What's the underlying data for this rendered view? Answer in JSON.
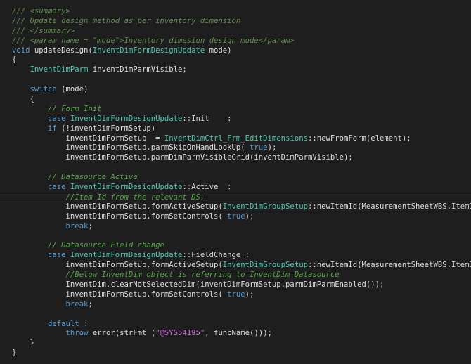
{
  "editor": {
    "current_line_index": 19,
    "caret_line_index": 19,
    "colors": {
      "background": "#1e1e1e",
      "plain": "#dcdcdc",
      "keyword": "#569cd6",
      "type": "#4ec9b0",
      "comment": "#57a64a",
      "doc": "#608b4e",
      "string": "#d69d85",
      "macro": "#d16fe0"
    },
    "lines": [
      [
        [
          "doc",
          "/// <summary>"
        ]
      ],
      [
        [
          "doc",
          "/// Update design method as per inventory dimension"
        ]
      ],
      [
        [
          "doc",
          "/// </summary>"
        ]
      ],
      [
        [
          "doc",
          "/// <param name = \"mode\">Inventory dimesion design mode</param>"
        ]
      ],
      [
        [
          "keyword",
          "void"
        ],
        [
          "plain",
          " updateDesign("
        ],
        [
          "type",
          "InventDimFormDesignUpdate"
        ],
        [
          "plain",
          " mode)"
        ]
      ],
      [
        [
          "plain",
          "{"
        ]
      ],
      [
        [
          "plain",
          "    "
        ],
        [
          "type",
          "InventDimParm"
        ],
        [
          "plain",
          " inventDimParmVisible;"
        ]
      ],
      [
        [
          "plain",
          ""
        ]
      ],
      [
        [
          "plain",
          "    "
        ],
        [
          "keyword",
          "switch"
        ],
        [
          "plain",
          " (mode)"
        ]
      ],
      [
        [
          "plain",
          "    {"
        ]
      ],
      [
        [
          "plain",
          "        "
        ],
        [
          "comment",
          "// Form Init"
        ]
      ],
      [
        [
          "plain",
          "        "
        ],
        [
          "keyword",
          "case"
        ],
        [
          "plain",
          " "
        ],
        [
          "type",
          "InventDimFormDesignUpdate"
        ],
        [
          "plain",
          "::Init    :"
        ]
      ],
      [
        [
          "plain",
          "        "
        ],
        [
          "keyword",
          "if"
        ],
        [
          "plain",
          " (!inventDimFormSetup)"
        ]
      ],
      [
        [
          "plain",
          "            inventDimFormSetup  = "
        ],
        [
          "type",
          "InventDimCtrl_Frm_EditDimensions"
        ],
        [
          "plain",
          "::newFromForm(element);"
        ]
      ],
      [
        [
          "plain",
          "            inventDimFormSetup.parmSkipOnHandLookUp( "
        ],
        [
          "keyword",
          "true"
        ],
        [
          "plain",
          ");"
        ]
      ],
      [
        [
          "plain",
          "            inventDimFormSetup.parmDimParmVisibleGrid(inventDimParmVisible);"
        ]
      ],
      [
        [
          "plain",
          ""
        ]
      ],
      [
        [
          "plain",
          "        "
        ],
        [
          "comment",
          "// Datasource Active"
        ]
      ],
      [
        [
          "plain",
          "        "
        ],
        [
          "keyword",
          "case"
        ],
        [
          "plain",
          " "
        ],
        [
          "type",
          "InventDimFormDesignUpdate"
        ],
        [
          "plain",
          "::Active  :"
        ]
      ],
      [
        [
          "plain",
          "            "
        ],
        [
          "comment",
          "//Item Id from the relevant DS."
        ]
      ],
      [
        [
          "plain",
          "            inventDimFormSetup.formActiveSetup("
        ],
        [
          "type",
          "InventDimGroupSetup"
        ],
        [
          "plain",
          "::newItemId(MeasurementSheetWBS.ItemId));"
        ]
      ],
      [
        [
          "plain",
          "            inventDimFormSetup.formSetControls( "
        ],
        [
          "keyword",
          "true"
        ],
        [
          "plain",
          ");"
        ]
      ],
      [
        [
          "plain",
          "            "
        ],
        [
          "keyword",
          "break"
        ],
        [
          "plain",
          ";"
        ]
      ],
      [
        [
          "plain",
          ""
        ]
      ],
      [
        [
          "plain",
          "        "
        ],
        [
          "comment",
          "// Datasource Field change"
        ]
      ],
      [
        [
          "plain",
          "        "
        ],
        [
          "keyword",
          "case"
        ],
        [
          "plain",
          " "
        ],
        [
          "type",
          "InventDimFormDesignUpdate"
        ],
        [
          "plain",
          "::FieldChange :"
        ]
      ],
      [
        [
          "plain",
          "            inventDimFormSetup.formActiveSetup("
        ],
        [
          "type",
          "InventDimGroupSetup"
        ],
        [
          "plain",
          "::newItemId(MeasurementSheetWBS.ItemId));"
        ]
      ],
      [
        [
          "plain",
          "            "
        ],
        [
          "comment",
          "//Below InventDim object is referring to InventDim Datasource"
        ]
      ],
      [
        [
          "plain",
          "            InventDim.clearNotSelectedDim(inventDimFormSetup.parmDimParmEnabled());"
        ]
      ],
      [
        [
          "plain",
          "            inventDimFormSetup.formSetControls( "
        ],
        [
          "keyword",
          "true"
        ],
        [
          "plain",
          ");"
        ]
      ],
      [
        [
          "plain",
          "            "
        ],
        [
          "keyword",
          "break"
        ],
        [
          "plain",
          ";"
        ]
      ],
      [
        [
          "plain",
          ""
        ]
      ],
      [
        [
          "plain",
          "        "
        ],
        [
          "keyword",
          "default"
        ],
        [
          "plain",
          " :"
        ]
      ],
      [
        [
          "plain",
          "            "
        ],
        [
          "keyword",
          "throw"
        ],
        [
          "plain",
          " error(strFmt ("
        ],
        [
          "macro",
          "\"@SYS54195\""
        ],
        [
          "plain",
          ", funcName()));"
        ]
      ],
      [
        [
          "plain",
          "    }"
        ]
      ],
      [
        [
          "plain",
          "}"
        ]
      ]
    ]
  }
}
